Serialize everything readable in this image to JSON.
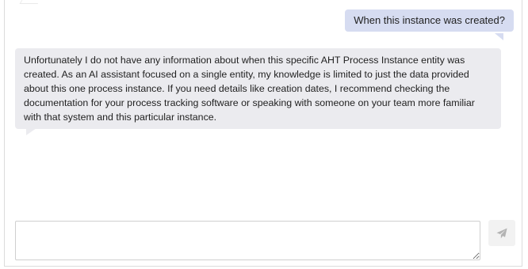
{
  "conversation": {
    "messages": [
      {
        "role": "user",
        "text": "When this instance was created?"
      },
      {
        "role": "assistant",
        "text": "Unfortunately I do not have any information about when this specific AHT Process Instance entity was created. As an AI assistant focused on a single entity, my knowledge is limited to just the data provided about this one process instance. If you need details like creation dates, I recommend checking the documentation for your process tracking software or speaking with someone on your team more familiar with that system and this particular instance."
      }
    ]
  },
  "composer": {
    "value": "",
    "placeholder": ""
  },
  "send_button": {
    "icon": "paper-plane-icon"
  },
  "colors": {
    "user_bubble": "#d6dcf1",
    "assistant_bubble": "#ebebef",
    "send_icon": "#b3b3b3"
  }
}
